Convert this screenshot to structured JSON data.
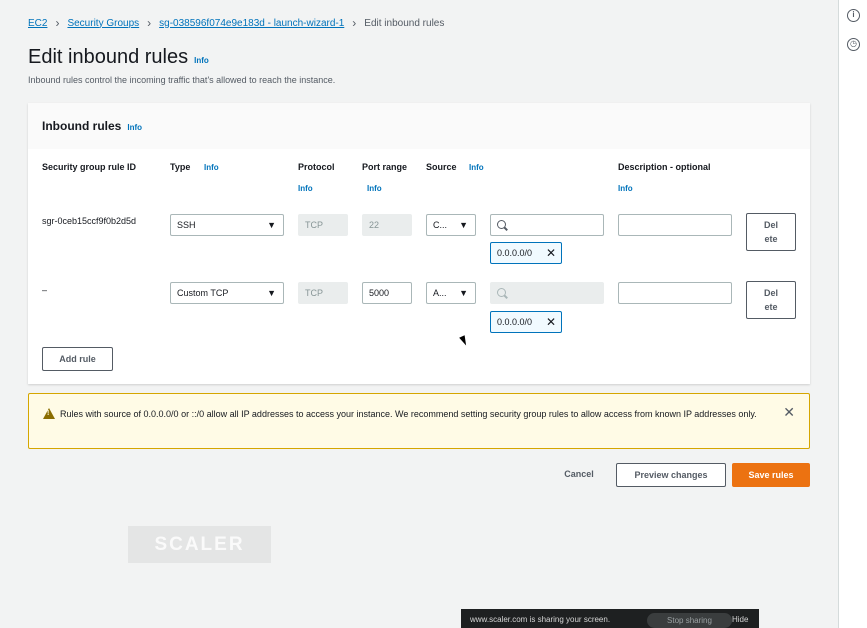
{
  "breadcrumb": {
    "items": [
      "EC2",
      "Security Groups",
      "sg-038596f074e9e183d - launch-wizard-1"
    ],
    "current": "Edit inbound rules"
  },
  "page": {
    "title": "Edit inbound rules",
    "info": "Info",
    "subtitle": "Inbound rules control the incoming traffic that's allowed to reach the instance."
  },
  "panel": {
    "title": "Inbound rules",
    "info": "Info",
    "columns": {
      "rule_id": "Security group rule ID",
      "type": "Type",
      "protocol": "Protocol",
      "port_range": "Port range",
      "source": "Source",
      "description": "Description - optional",
      "info": "Info"
    },
    "rules": [
      {
        "id": "sgr-0ceb15ccf9f0b2d5d",
        "type": "SSH",
        "protocol": "TCP",
        "port": "22",
        "source_type": "C...",
        "search_value": "",
        "token": "0.0.0.0/0",
        "description": "",
        "delete_label_1": "Del",
        "delete_label_2": "ete"
      },
      {
        "id": "–",
        "type": "Custom TCP",
        "protocol": "TCP",
        "port": "5000",
        "source_type": "A...",
        "search_value": "",
        "token": "0.0.0.0/0",
        "description": "",
        "delete_label_1": "Del",
        "delete_label_2": "ete"
      }
    ],
    "add_rule": "Add rule"
  },
  "warning": {
    "text": "Rules with source of 0.0.0.0/0 or ::/0 allow all IP addresses to access your instance. We recommend setting security group rules to allow access from known IP addresses only."
  },
  "footer": {
    "cancel": "Cancel",
    "preview": "Preview changes",
    "save": "Save rules"
  },
  "watermark": "SCALER",
  "share_bar": {
    "text": "www.scaler.com is sharing your screen.",
    "stop": "Stop sharing",
    "hide": "Hide"
  },
  "colors": {
    "link": "#0073bb",
    "primary": "#ec7211",
    "warning_bg": "#fffbe6",
    "warning_border": "#d5a600"
  }
}
